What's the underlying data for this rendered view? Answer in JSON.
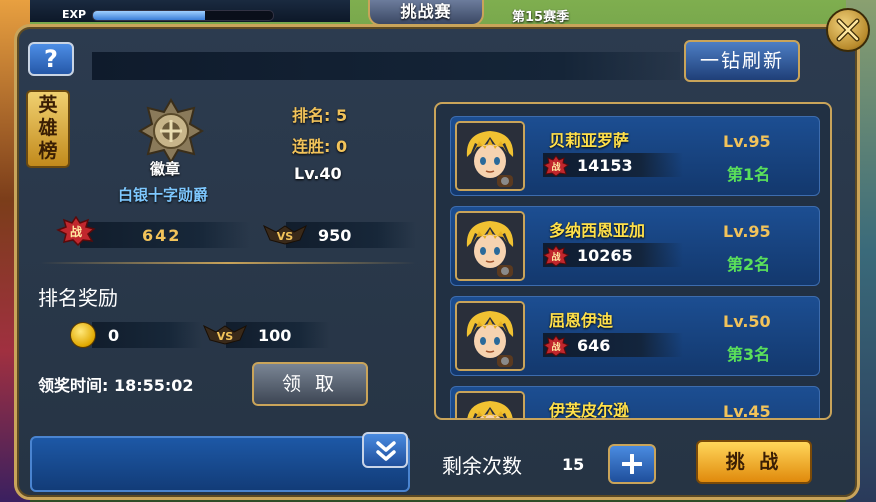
{
  "hud": {
    "exp_label": "EXP",
    "exp_fraction": 0.62,
    "mode_title": "挑战赛",
    "season": "第15赛季"
  },
  "panel": {
    "help_label": "?",
    "refresh_label": "一钻刷新",
    "hero_board_label": "英雄榜"
  },
  "player": {
    "badge_name": "徽章",
    "rank_title": "白银十字勋爵",
    "rank": "排名: 5",
    "win_streak": "连胜: 0",
    "level": "Lv.40",
    "power": "642",
    "vs_points": "950"
  },
  "reward": {
    "title": "排名奖励",
    "coins": "0",
    "vs_points": "100",
    "claim_time": "领奖时间: 18:55:02",
    "claim_label": "领 取"
  },
  "opponents": [
    {
      "name": "贝莉亚罗萨",
      "power": "14153",
      "level": "Lv.95",
      "rank": "第1名"
    },
    {
      "name": "多纳西恩亚加",
      "power": "10265",
      "level": "Lv.95",
      "rank": "第2名"
    },
    {
      "name": "屈恩伊迪",
      "power": "646",
      "level": "Lv.50",
      "rank": "第3名"
    },
    {
      "name": "伊芙皮尔逊",
      "power": "",
      "level": "Lv.45",
      "rank": ""
    }
  ],
  "footer": {
    "remaining_label": "剩余次数",
    "remaining_count": "15",
    "challenge_label": "挑 战"
  },
  "colors": {
    "gold": "#c9a45a",
    "name_yellow": "#ffe04a",
    "rank_green": "#5ae05a",
    "panel": "#2c3b4f"
  }
}
